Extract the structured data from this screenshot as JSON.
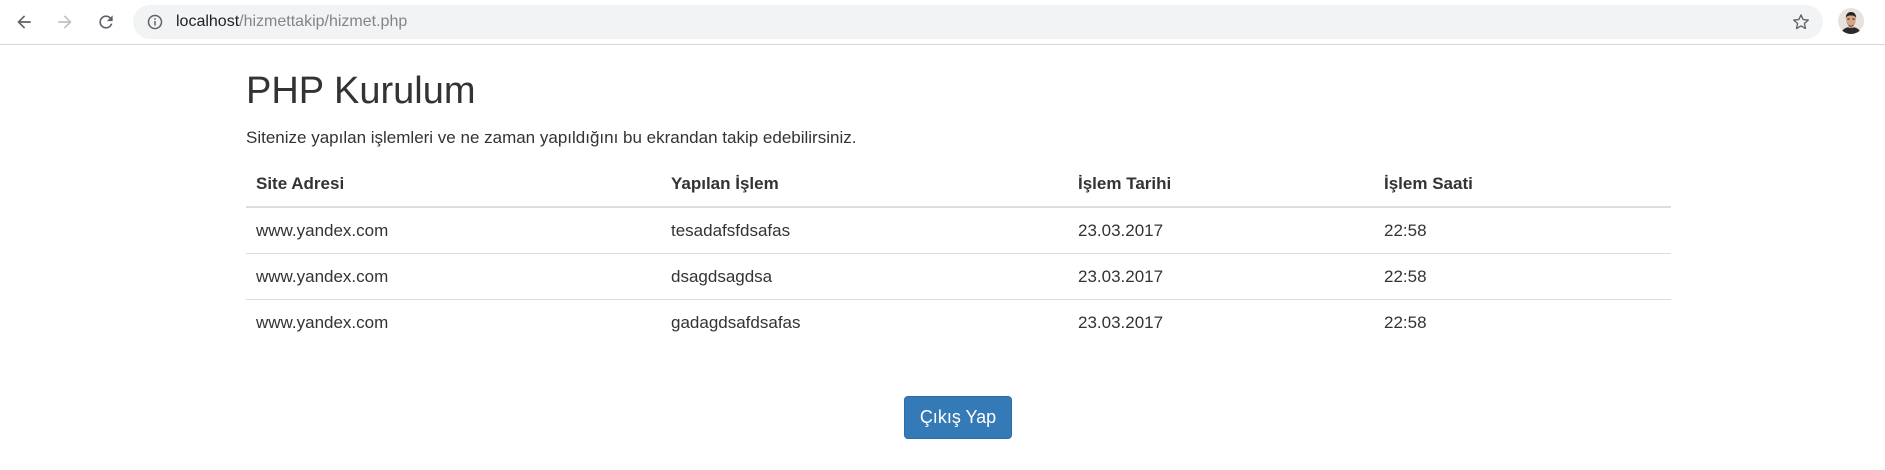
{
  "browser": {
    "url_host": "localhost",
    "url_path": "/hizmettakip/hizmet.php"
  },
  "page": {
    "title": "PHP Kurulum",
    "description": "Sitenize yapılan işlemleri ve ne zaman yapıldığını bu ekrandan takip edebilirsiniz."
  },
  "table": {
    "headers": [
      "Site Adresi",
      "Yapılan İşlem",
      "İşlem Tarihi",
      "İşlem Saati"
    ],
    "rows": [
      [
        "www.yandex.com",
        "tesadafsfdsafas",
        "23.03.2017",
        "22:58"
      ],
      [
        "www.yandex.com",
        "dsagdsagdsa",
        "23.03.2017",
        "22:58"
      ],
      [
        "www.yandex.com",
        "gadagdsafdsafas",
        "23.03.2017",
        "22:58"
      ]
    ]
  },
  "actions": {
    "logout_label": "Çıkış Yap"
  },
  "colors": {
    "primary_button": "#337ab7",
    "text": "#333333",
    "omnibox_bg": "#f1f3f4"
  },
  "icons": [
    "back-arrow-icon",
    "forward-arrow-icon",
    "reload-icon",
    "info-icon",
    "star-icon",
    "profile-avatar"
  ]
}
